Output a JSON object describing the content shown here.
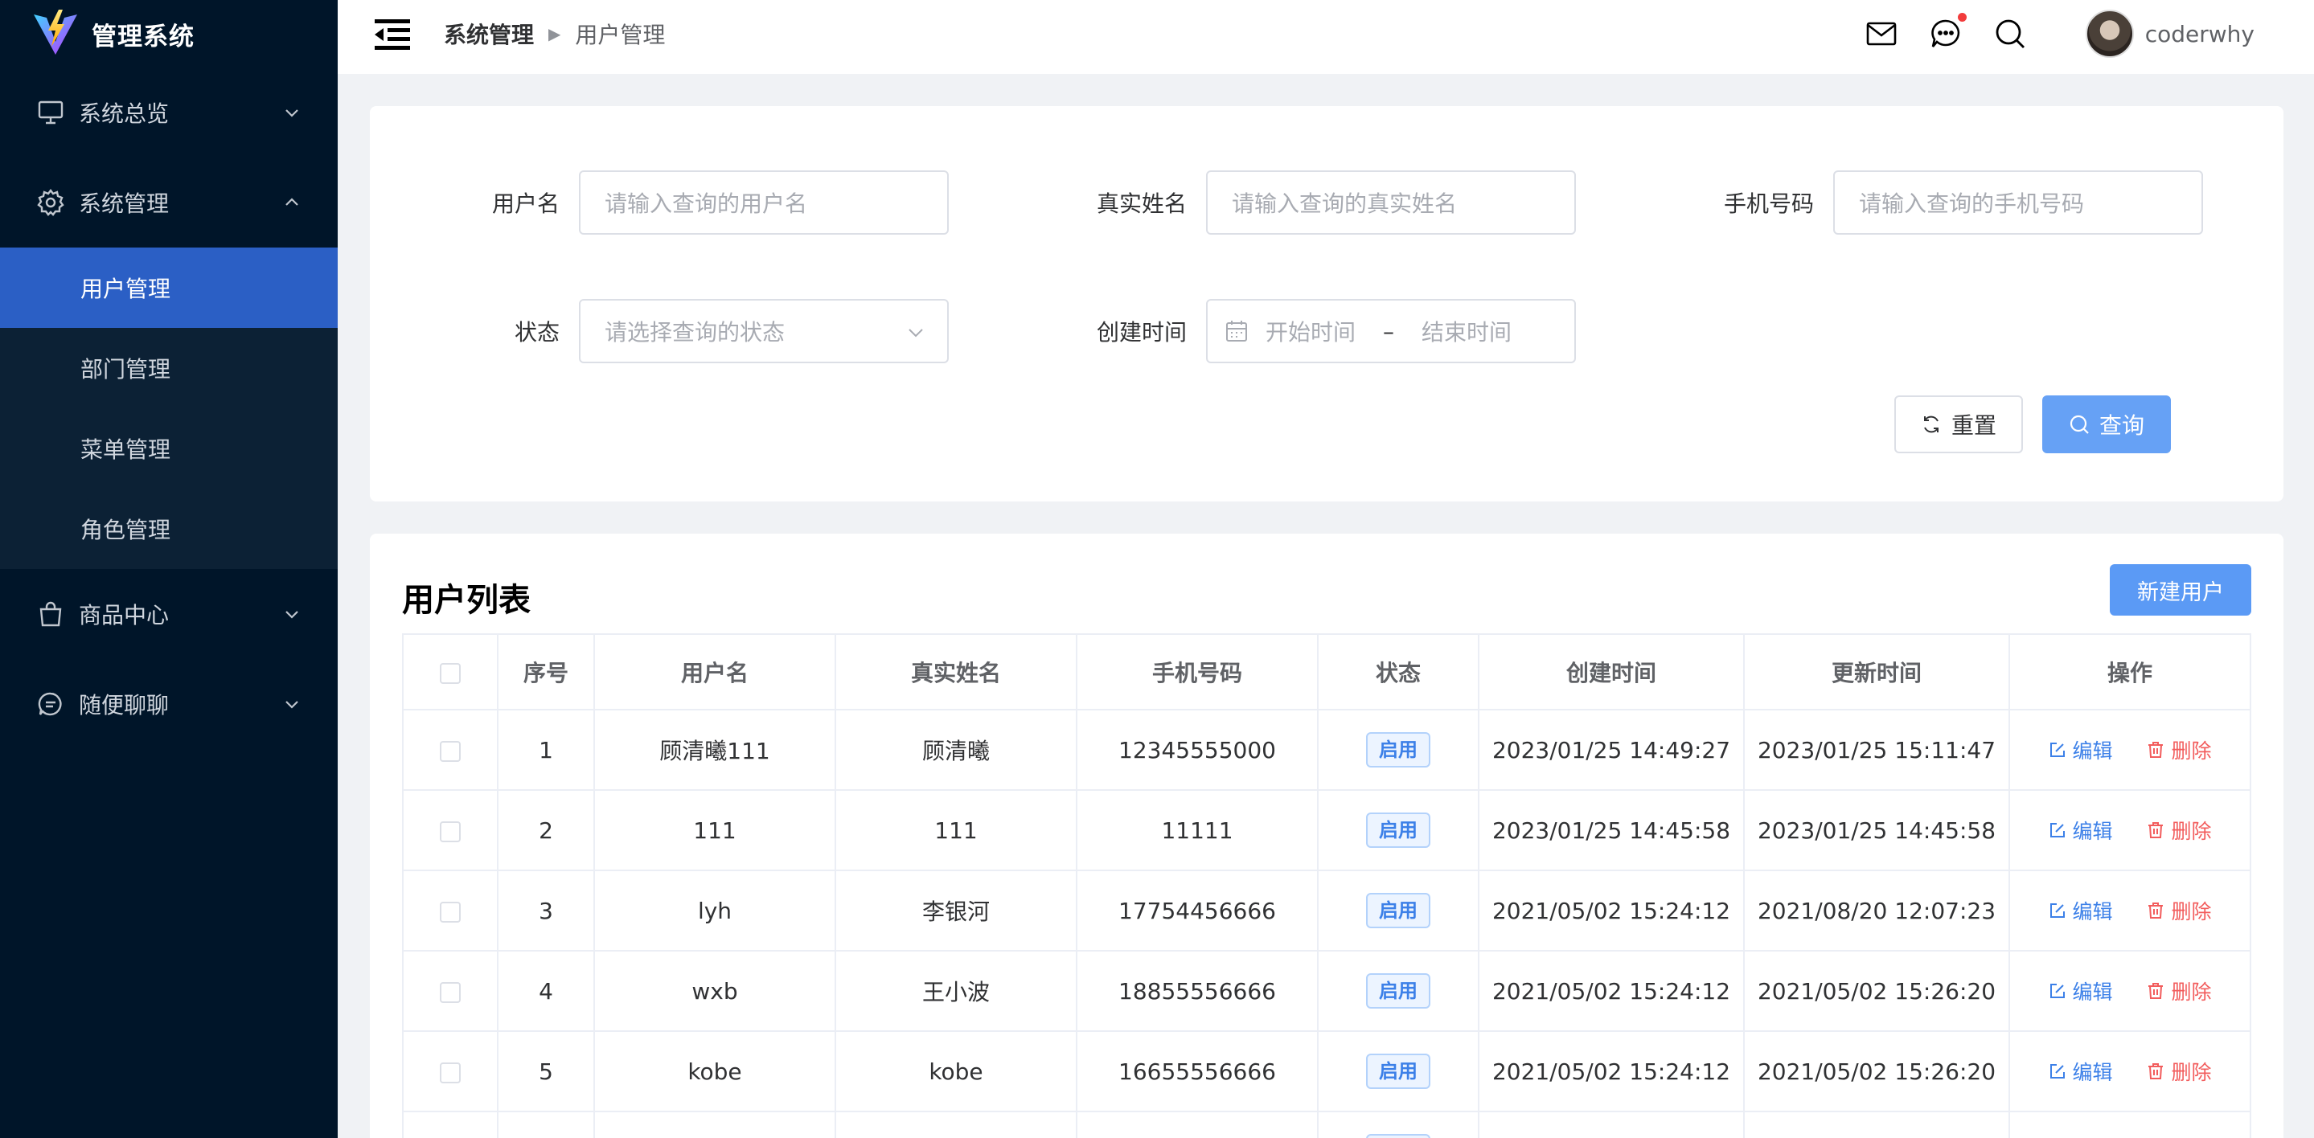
{
  "app": {
    "title": "管理系统"
  },
  "sidebar": {
    "menus": [
      {
        "label": "系统总览",
        "icon": "monitor-icon",
        "expanded": false
      },
      {
        "label": "系统管理",
        "icon": "gear-icon",
        "expanded": true,
        "children": [
          {
            "label": "用户管理",
            "active": true
          },
          {
            "label": "部门管理",
            "active": false
          },
          {
            "label": "菜单管理",
            "active": false
          },
          {
            "label": "角色管理",
            "active": false
          }
        ]
      },
      {
        "label": "商品中心",
        "icon": "shopping-bag-icon",
        "expanded": false
      },
      {
        "label": "随便聊聊",
        "icon": "chat-icon",
        "expanded": false
      }
    ]
  },
  "header": {
    "breadcrumb": [
      "系统管理",
      "用户管理"
    ],
    "username": "coderwhy",
    "icons": [
      "mail-icon",
      "message-icon",
      "search-icon"
    ]
  },
  "search": {
    "fields": {
      "username": {
        "label": "用户名",
        "placeholder": "请输入查询的用户名"
      },
      "realname": {
        "label": "真实姓名",
        "placeholder": "请输入查询的真实姓名"
      },
      "phone": {
        "label": "手机号码",
        "placeholder": "请输入查询的手机号码"
      },
      "status": {
        "label": "状态",
        "placeholder": "请选择查询的状态"
      },
      "created": {
        "label": "创建时间",
        "start_placeholder": "开始时间",
        "separator": "–",
        "end_placeholder": "结束时间"
      }
    },
    "reset_label": "重置",
    "query_label": "查询"
  },
  "list": {
    "title": "用户列表",
    "new_button": "新建用户",
    "columns": [
      "序号",
      "用户名",
      "真实姓名",
      "手机号码",
      "状态",
      "创建时间",
      "更新时间",
      "操作"
    ],
    "rows": [
      {
        "index": "1",
        "username": "顾清曦111",
        "realname": "顾清曦",
        "phone": "12345555000",
        "status": "启用",
        "created": "2023/01/25 14:49:27",
        "updated": "2023/01/25 15:11:47"
      },
      {
        "index": "2",
        "username": "111",
        "realname": "111",
        "phone": "11111",
        "status": "启用",
        "created": "2023/01/25 14:45:58",
        "updated": "2023/01/25 14:45:58"
      },
      {
        "index": "3",
        "username": "lyh",
        "realname": "李银河",
        "phone": "17754456666",
        "status": "启用",
        "created": "2021/05/02 15:24:12",
        "updated": "2021/08/20 12:07:23"
      },
      {
        "index": "4",
        "username": "wxb",
        "realname": "王小波",
        "phone": "18855556666",
        "status": "启用",
        "created": "2021/05/02 15:24:12",
        "updated": "2021/05/02 15:26:20"
      },
      {
        "index": "5",
        "username": "kobe",
        "realname": "kobe",
        "phone": "16655556666",
        "status": "启用",
        "created": "2021/05/02 15:24:12",
        "updated": "2021/05/02 15:26:20"
      }
    ],
    "edit_label": "编辑",
    "delete_label": "删除"
  },
  "colors": {
    "sidebar_bg": "#001529",
    "active": "#2b5fc5",
    "primary": "#66a1f5",
    "danger": "#f25c5c"
  }
}
